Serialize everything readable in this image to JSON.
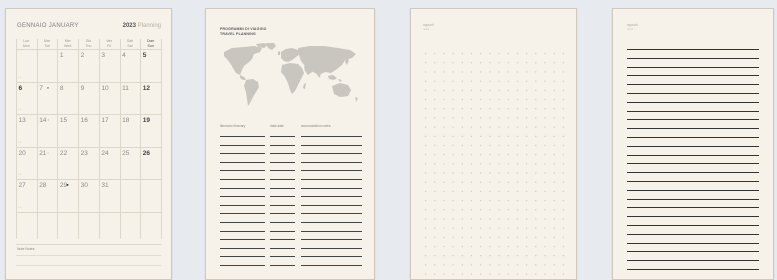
{
  "calendar": {
    "month_label": "GENNAIO   JANUARY",
    "year": "2023",
    "planning": "Planning",
    "day_names": [
      {
        "it": "Lun",
        "en": "Mon"
      },
      {
        "it": "Mar",
        "en": "Tue"
      },
      {
        "it": "Mer",
        "en": "Wed"
      },
      {
        "it": "Gio",
        "en": "Thu"
      },
      {
        "it": "Ven",
        "en": "Fri"
      },
      {
        "it": "Sab",
        "en": "Sat"
      },
      {
        "it": "Dom",
        "en": "Sun"
      }
    ],
    "weeks": [
      [
        "",
        "",
        "1",
        "2",
        "3",
        "4",
        "5"
      ],
      [
        "6",
        "7",
        "8",
        "9",
        "10",
        "11",
        "12"
      ],
      [
        "13",
        "14",
        "15",
        "16",
        "17",
        "18",
        "19"
      ],
      [
        "20",
        "21",
        "22",
        "23",
        "24",
        "25",
        "26"
      ],
      [
        "27",
        "28",
        "29",
        "30",
        "31",
        "",
        ""
      ]
    ],
    "notes_label": "Note   Notes"
  },
  "travel": {
    "title_line1": "PROGRAMMI DI VIAGGIO",
    "title_line2": "TRAVEL PLANNING",
    "columns": [
      "itinerario   itinerary",
      "data   date",
      "accomodation   notes"
    ]
  },
  "dot_page": {
    "title": "appunti",
    "subtitle": "notes"
  },
  "lined_page": {
    "title": "appunti",
    "subtitle": "notes"
  }
}
